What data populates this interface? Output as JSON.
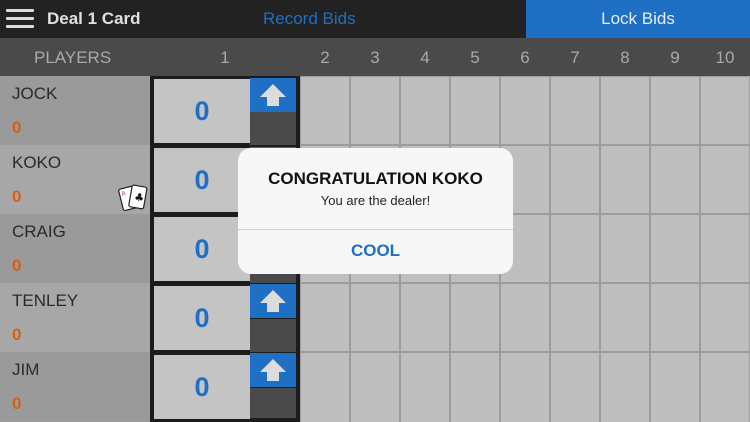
{
  "topbar": {
    "title": "Deal 1 Card",
    "record_bids": "Record Bids",
    "lock_bids": "Lock Bids"
  },
  "header": {
    "players_label": "PLAYERS",
    "rounds": [
      "1",
      "2",
      "3",
      "4",
      "5",
      "6",
      "7",
      "8",
      "9",
      "10"
    ]
  },
  "players": [
    {
      "name": "JOCK",
      "score": "0",
      "bid": "0",
      "has_arrow": true,
      "is_dealer": false
    },
    {
      "name": "KOKO",
      "score": "0",
      "bid": "0",
      "has_arrow": true,
      "is_dealer": true
    },
    {
      "name": "CRAIG",
      "score": "0",
      "bid": "0",
      "has_arrow": false,
      "is_dealer": false
    },
    {
      "name": "TENLEY",
      "score": "0",
      "bid": "0",
      "has_arrow": true,
      "is_dealer": false
    },
    {
      "name": "JIM",
      "score": "0",
      "bid": "0",
      "has_arrow": true,
      "is_dealer": false
    }
  ],
  "icons": {
    "menu": "hamburger-menu-icon",
    "bid_up": "up-arrow-icon",
    "dealer": "dealer-cards-icon"
  },
  "alert": {
    "title": "CONGRATULATION KOKO",
    "message": "You are the dealer!",
    "button": "COOL"
  },
  "colors": {
    "accent": "#1f6fc4",
    "score": "#d2601a",
    "topbar": "#222222",
    "header": "#4a4a4a"
  }
}
